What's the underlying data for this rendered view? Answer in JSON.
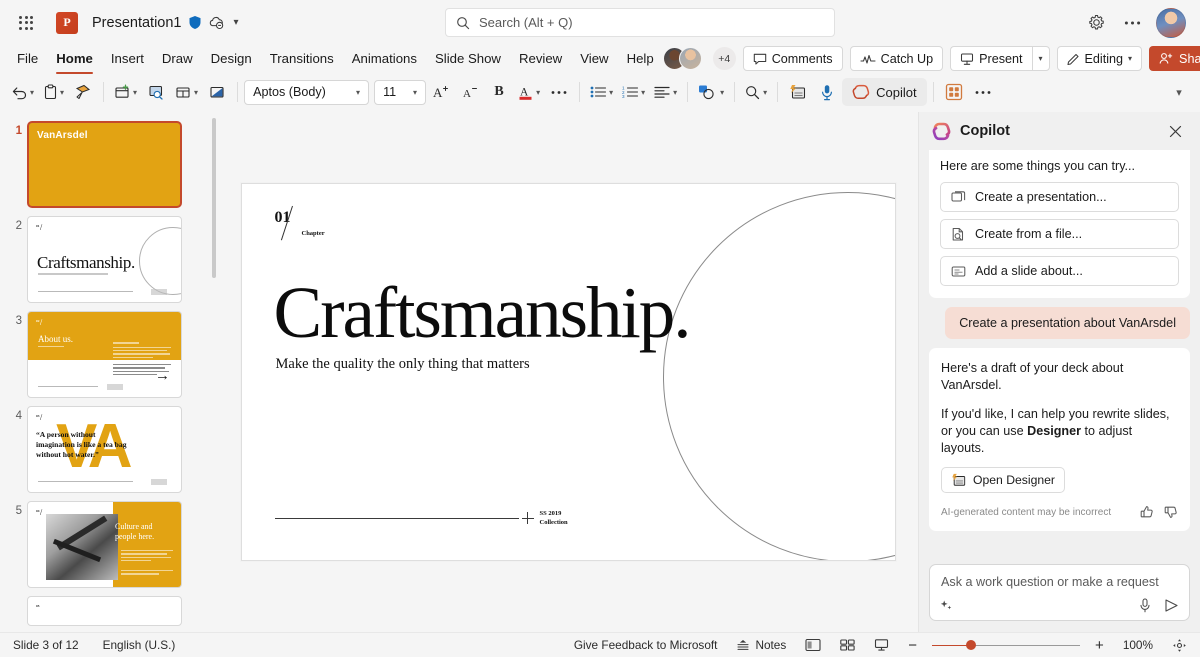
{
  "titlebar": {
    "app_launcher": "App launcher",
    "doc_title": "Presentation1",
    "search_placeholder": "Search (Alt + Q)",
    "settings": "Settings",
    "more": "More options"
  },
  "menubar": {
    "tabs": [
      {
        "label": "File",
        "active": false
      },
      {
        "label": "Home",
        "active": true
      },
      {
        "label": "Insert",
        "active": false
      },
      {
        "label": "Draw",
        "active": false
      },
      {
        "label": "Design",
        "active": false
      },
      {
        "label": "Transitions",
        "active": false
      },
      {
        "label": "Animations",
        "active": false
      },
      {
        "label": "Slide Show",
        "active": false
      },
      {
        "label": "Review",
        "active": false
      },
      {
        "label": "View",
        "active": false
      },
      {
        "label": "Help",
        "active": false
      }
    ],
    "coauthor_overflow": "+4",
    "comments_label": "Comments",
    "catchup_label": "Catch Up",
    "present_label": "Present",
    "editing_label": "Editing",
    "share_label": "Share"
  },
  "ribbon": {
    "font_name": "Aptos (Body)",
    "font_size": "11",
    "copilot_label": "Copilot",
    "bold_label": "B"
  },
  "thumbnails": [
    {
      "number": "1",
      "selected": true,
      "kind": "cover",
      "title": "VanArsdel"
    },
    {
      "number": "2",
      "selected": false,
      "kind": "craftsmanship",
      "title": "Craftsmanship."
    },
    {
      "number": "3",
      "selected": false,
      "kind": "about",
      "title": "About us."
    },
    {
      "number": "4",
      "selected": false,
      "kind": "quote",
      "title": "“A person without imagination is like a tea bag without hot water.”"
    },
    {
      "number": "5",
      "selected": false,
      "kind": "culture",
      "title": "Culture and people here."
    }
  ],
  "slide": {
    "chapter_number": "01",
    "chapter_label": "Chapter",
    "title": "Craftsmanship.",
    "subtitle": "Make the quality the only thing that matters",
    "footer_line1": "SS 2019",
    "footer_line2": "Collection"
  },
  "copilot": {
    "title": "Copilot",
    "close": "Close",
    "intro": "Here are some things you can try...",
    "suggestions": [
      {
        "label": "Create a presentation...",
        "icon": "slides-icon"
      },
      {
        "label": "Create from a file...",
        "icon": "file-search-icon"
      },
      {
        "label": "Add a slide about...",
        "icon": "add-slide-icon"
      }
    ],
    "user_message": "Create a presentation about VanArsdel",
    "reply_p1": "Here's a draft of your deck about VanArsdel.",
    "reply_p2_a": "If you'd like, I can help you rewrite slides, or you can use ",
    "reply_p2_bold": "Designer",
    "reply_p2_b": " to adjust layouts.",
    "open_designer": "Open Designer",
    "disclaimer": "AI-generated content may be incorrect",
    "input_placeholder": "Ask a work question or make a request"
  },
  "statusbar": {
    "slide_count": "Slide 3 of 12",
    "language": "English (U.S.)",
    "feedback": "Give Feedback to Microsoft",
    "notes": "Notes",
    "zoom_out": "−",
    "zoom_in": "+",
    "zoom_level": "100%"
  },
  "colors": {
    "accent_red": "#c4492c",
    "brand_gold": "#e2a313",
    "copilot_pink": "#f6ddd4"
  }
}
